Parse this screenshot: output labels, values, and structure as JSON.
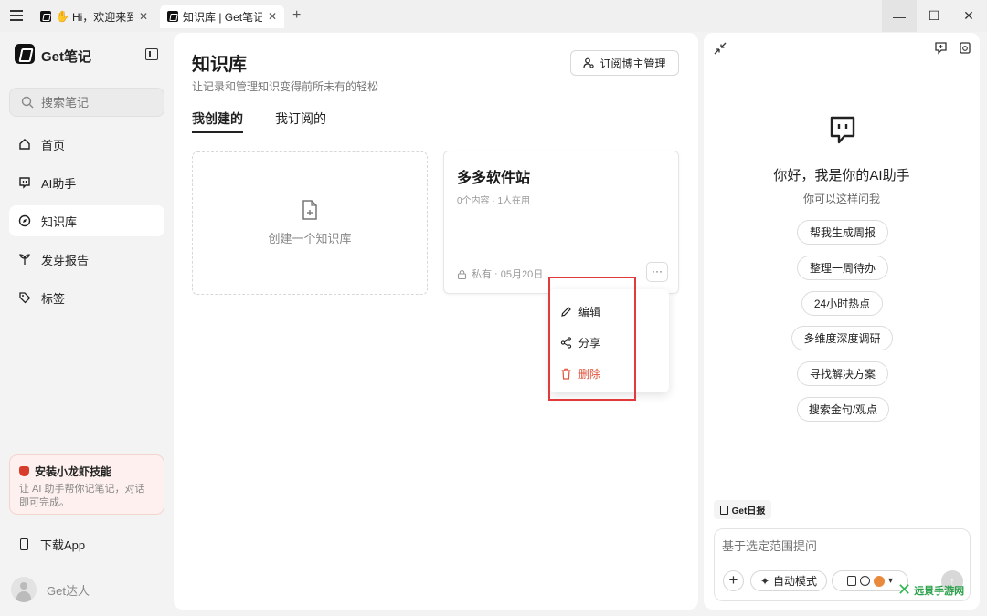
{
  "titlebar": {
    "tabs": [
      {
        "label": "Hi，欢迎来到Ge",
        "active": false
      },
      {
        "label": "知识库 | Get笔记",
        "active": true
      }
    ],
    "new_tab": "+",
    "window_controls": {
      "minimize": "—",
      "maximize": "☐",
      "close": "✕"
    }
  },
  "sidebar": {
    "brand": "Get笔记",
    "search_placeholder": "搜索笔记",
    "items": [
      {
        "label": "首页",
        "icon": "home-icon",
        "active": false
      },
      {
        "label": "AI助手",
        "icon": "ai-assistant-icon",
        "active": false
      },
      {
        "label": "知识库",
        "icon": "knowledge-base-icon",
        "active": true
      },
      {
        "label": "发芽报告",
        "icon": "sprout-icon",
        "active": false
      },
      {
        "label": "标签",
        "icon": "tag-icon",
        "active": false
      }
    ],
    "promo": {
      "title": "安装小龙虾技能",
      "desc": "让 AI 助手帮你记笔记，对话即可完成。"
    },
    "download": "下载App",
    "user": "Get达人"
  },
  "main": {
    "title": "知识库",
    "subtitle": "让记录和管理知识变得前所未有的轻松",
    "subscribe_button": "订阅博主管理",
    "tabs": [
      {
        "label": "我创建的",
        "active": true
      },
      {
        "label": "我订阅的",
        "active": false
      }
    ],
    "create_card": "创建一个知识库",
    "kb_card": {
      "title": "多多软件站",
      "meta": "0个内容 · 1人在用",
      "privacy": "私有",
      "date": "05月20日",
      "more": "···"
    },
    "menu": {
      "edit": "编辑",
      "share": "分享",
      "delete": "删除"
    }
  },
  "ai_panel": {
    "greeting": "你好，我是你的AI助手",
    "hint": "你可以这样问我",
    "suggestions": [
      "帮我生成周报",
      "整理一周待办",
      "24小时热点",
      "多维度深度调研",
      "寻找解决方案",
      "搜索金句/观点"
    ],
    "daily_tag": "Get日报",
    "input_placeholder": "基于选定范围提问",
    "mode": "自动模式",
    "send": "↑"
  },
  "watermark": {
    "text": "远景手游网"
  },
  "colors": {
    "accent_red": "#e03a3a",
    "delete_red": "#e0533c",
    "watermark_green": "#2aa14a"
  }
}
